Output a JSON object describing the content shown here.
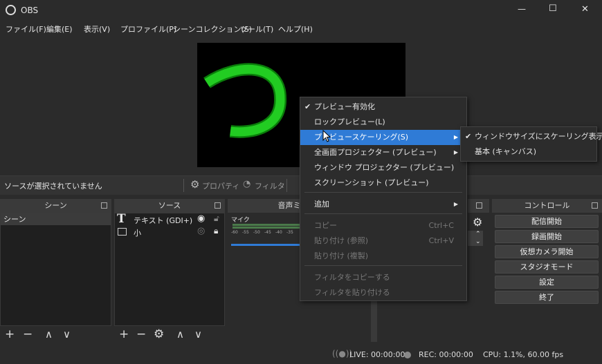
{
  "window": {
    "title": "OBS",
    "minimize": "—",
    "maximize": "☐",
    "close": "✕"
  },
  "menu": [
    "ファイル(F)",
    "編集(E)",
    "表示(V)",
    "プロファイル(P)",
    "シーンコレクション(S)",
    "ツール(T)",
    "ヘルプ(H)"
  ],
  "source_bar": {
    "status": "ソースが選択されていません",
    "properties": "プロパティ",
    "filters": "フィルタ"
  },
  "docks": {
    "scenes": {
      "title": "シーン",
      "items": [
        "シーン"
      ]
    },
    "sources": {
      "title": "ソース",
      "items": [
        "テキスト (GDI+)",
        "小"
      ]
    },
    "mixer": {
      "title": "音声ミ",
      "channel": "マイク",
      "ticks": [
        "-60",
        "-55",
        "-50",
        "-45",
        "-40",
        "-35"
      ]
    },
    "controls": {
      "title": "コントロール",
      "buttons": [
        "配信開始",
        "録画開始",
        "仮想カメラ開始",
        "スタジオモード",
        "設定",
        "終了"
      ]
    }
  },
  "context_menu": {
    "items": [
      {
        "label": "プレビュー有効化",
        "checked": true
      },
      {
        "label": "ロックプレビュー(L)"
      },
      {
        "label": "プレビュースケーリング(S)",
        "submenu": true
      },
      {
        "label": "全画面プロジェクター (プレビュー)",
        "submenu": true
      },
      {
        "label": "ウィンドウ プロジェクター (プレビュー)"
      },
      {
        "label": "スクリーンショット (プレビュー)"
      },
      {
        "label": "追加",
        "submenu": true
      },
      {
        "label": "コピー",
        "shortcut": "Ctrl+C",
        "disabled": true
      },
      {
        "label": "貼り付け (参照)",
        "shortcut": "Ctrl+V",
        "disabled": true
      },
      {
        "label": "貼り付け (複製)",
        "disabled": true
      },
      {
        "label": "フィルタをコピーする",
        "disabled": true
      },
      {
        "label": "フィルタを貼り付ける",
        "disabled": true
      }
    ],
    "check_mark": "✔",
    "arrow": "▶"
  },
  "submenu": {
    "items": [
      {
        "label": "ウィンドウサイズにスケーリング表示",
        "checked": true
      },
      {
        "label": "基本 (キャンバス)"
      }
    ]
  },
  "status": {
    "live": "LIVE: 00:00:00",
    "rec": "REC: 00:00:00",
    "cpu": "CPU: 1.1%, 60.00 fps"
  },
  "toolbar": {
    "add": "+",
    "remove": "−",
    "up": "∧",
    "down": "∨",
    "gear": "⚙"
  },
  "colors": {
    "accent": "#2f7bd6",
    "green": "#1fc21f",
    "bg": "#2b2b2b"
  }
}
